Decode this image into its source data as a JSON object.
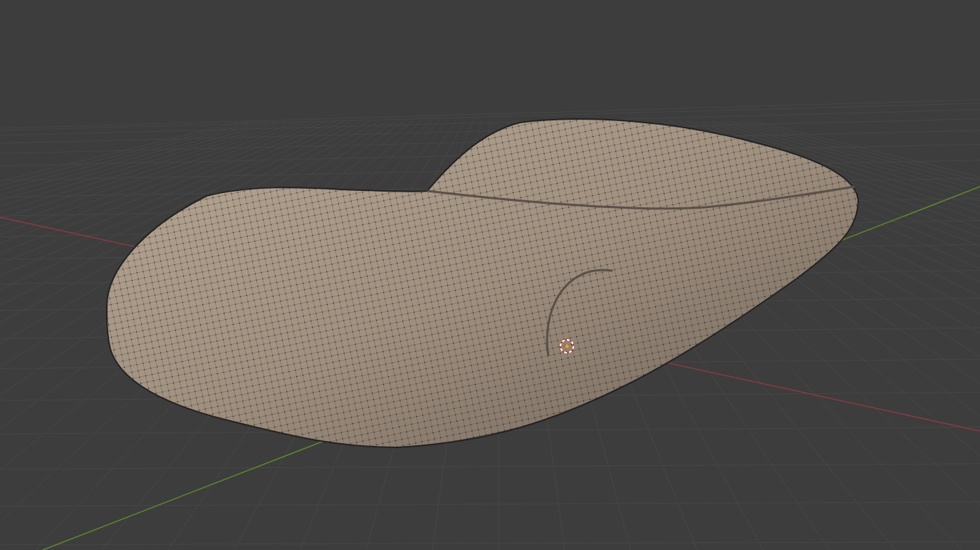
{
  "viewport": {
    "show_grid": true,
    "show_axes": true,
    "show_cursor": true,
    "show_wireframe": true
  }
}
